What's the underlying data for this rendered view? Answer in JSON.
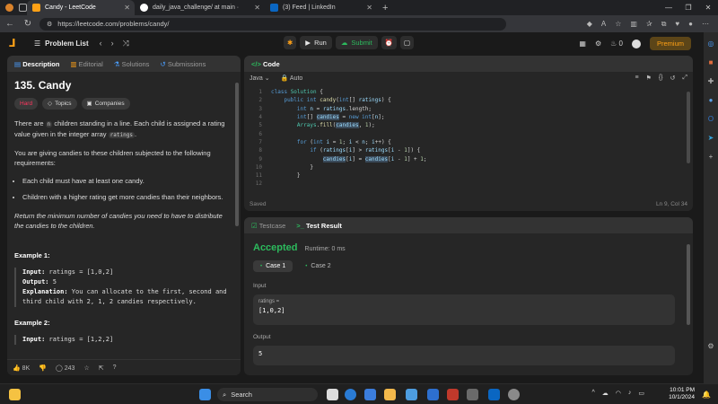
{
  "browser": {
    "tabs": [
      {
        "title": "Candy - LeetCode",
        "active": true,
        "color": "#ffa116"
      },
      {
        "title": "daily_java_challenge/ at main · ",
        "active": false,
        "color": "#ffffff"
      },
      {
        "title": "(3) Feed | LinkedIn",
        "active": false,
        "color": "#0a66c2"
      }
    ],
    "url": "https://leetcode.com/problems/candy/"
  },
  "nav": {
    "problem_list": "Problem List",
    "run": "Run",
    "submit": "Submit",
    "premium": "Premium",
    "streak": "0"
  },
  "description": {
    "tabs": [
      "Description",
      "Editorial",
      "Solutions",
      "Submissions"
    ],
    "title": "135. Candy",
    "tags": [
      "Hard",
      "Topics",
      "Companies"
    ],
    "p1a": "There are ",
    "p1_n": "n",
    "p1b": " children standing in a line. Each child is assigned a rating value given in the integer array ",
    "p1_arr": "ratings",
    "p1c": ".",
    "p2": "You are giving candies to these children subjected to the following requirements:",
    "bullets": [
      "Each child must have at least one candy.",
      "Children with a higher rating get more candies than their neighbors."
    ],
    "p3": "Return the minimum number of candies you need to have to distribute the candies to the children.",
    "ex1_title": "Example 1:",
    "ex1_input_label": "Input:",
    "ex1_input": " ratings = [1,0,2]",
    "ex1_output_label": "Output:",
    "ex1_output": " 5",
    "ex1_expl_label": "Explanation:",
    "ex1_expl": " You can allocate to the first, second and third child with 2, 1, 2 candies respectively.",
    "ex2_title": "Example 2:",
    "ex2_input_label": "Input:",
    "ex2_input": " ratings = [1,2,2]",
    "likes": "8K",
    "comments": "243"
  },
  "code": {
    "header": "Code",
    "language": "Java",
    "mode": "Auto",
    "status": "Saved",
    "cursor": "Ln 9, Col 34",
    "lines": [
      "class Solution {",
      "    public int candy(int[] ratings) {",
      "        int n = ratings.length;",
      "        int[] candies = new int[n];",
      "        Arrays.fill(candies, 1);",
      "",
      "        for (int i = 1; i < n; i++) {",
      "            if (ratings[i] > ratings[i - 1]) {",
      "                candies[i] = candies[i - 1] + 1;",
      "            }",
      "        }",
      ""
    ]
  },
  "result": {
    "tabs": [
      "Testcase",
      "Test Result"
    ],
    "verdict": "Accepted",
    "runtime": "Runtime: 0 ms",
    "cases": [
      "Case 1",
      "Case 2"
    ],
    "input_label": "Input",
    "var_name": "ratings =",
    "input_value": "[1,0,2]",
    "output_label": "Output",
    "output_value": "5"
  },
  "taskbar": {
    "search": "Search",
    "time": "10:01 PM",
    "date": "10/1/2024"
  }
}
